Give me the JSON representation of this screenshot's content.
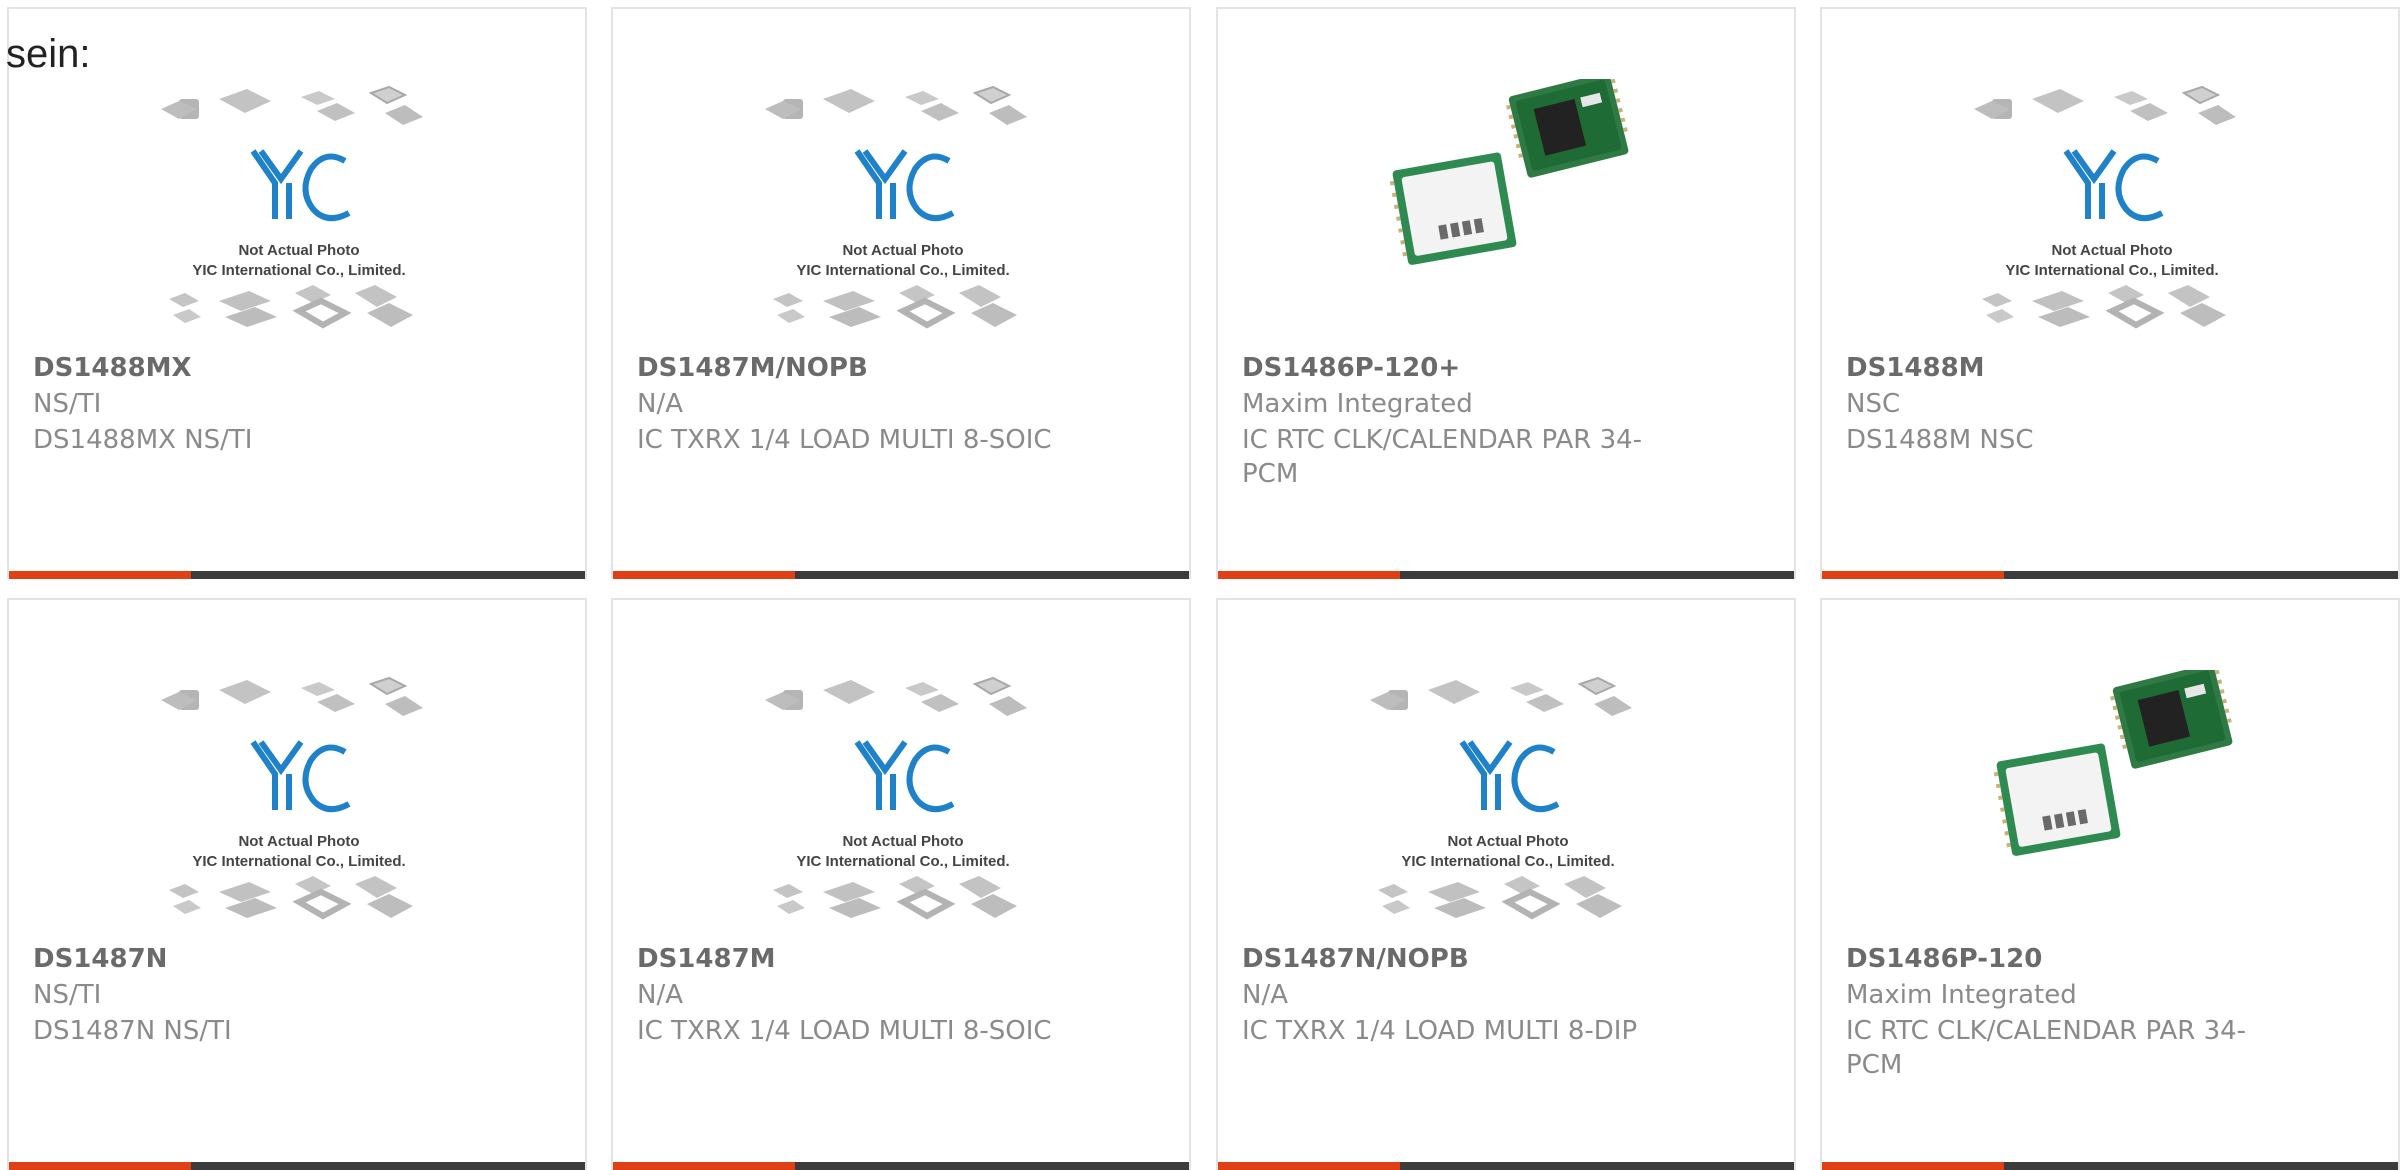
{
  "lead_text": "sein:",
  "placeholder_photo": {
    "caption_line1": "Not Actual Photo",
    "caption_line2": "YIC International Co., Limited."
  },
  "colors": {
    "accent": "#e04016",
    "bar": "#3c3c3c",
    "logo_blue": "#1f82c8"
  },
  "products": [
    {
      "part_number": "DS1488MX",
      "manufacturer": "NS/TI",
      "description": "DS1488MX NS/TI",
      "image": "placeholder"
    },
    {
      "part_number": "DS1487M/NOPB",
      "manufacturer": "N/A",
      "description": "IC TXRX 1/4 LOAD MULTI 8-SOIC",
      "image": "placeholder"
    },
    {
      "part_number": "DS1486P-120+",
      "manufacturer": "Maxim Integrated",
      "description": "IC RTC CLK/CALENDAR PAR 34-PCM",
      "image": "pcb-module"
    },
    {
      "part_number": "DS1488M",
      "manufacturer": "NSC",
      "description": "DS1488M NSC",
      "image": "placeholder"
    },
    {
      "part_number": "DS1487N",
      "manufacturer": "NS/TI",
      "description": "DS1487N NS/TI",
      "image": "placeholder"
    },
    {
      "part_number": "DS1487M",
      "manufacturer": "N/A",
      "description": "IC TXRX 1/4 LOAD MULTI 8-SOIC",
      "image": "placeholder"
    },
    {
      "part_number": "DS1487N/NOPB",
      "manufacturer": "N/A",
      "description": "IC TXRX 1/4 LOAD MULTI 8-DIP",
      "image": "placeholder"
    },
    {
      "part_number": "DS1486P-120",
      "manufacturer": "Maxim Integrated",
      "description": "IC RTC CLK/CALENDAR PAR 34-PCM",
      "image": "pcb-module"
    }
  ]
}
